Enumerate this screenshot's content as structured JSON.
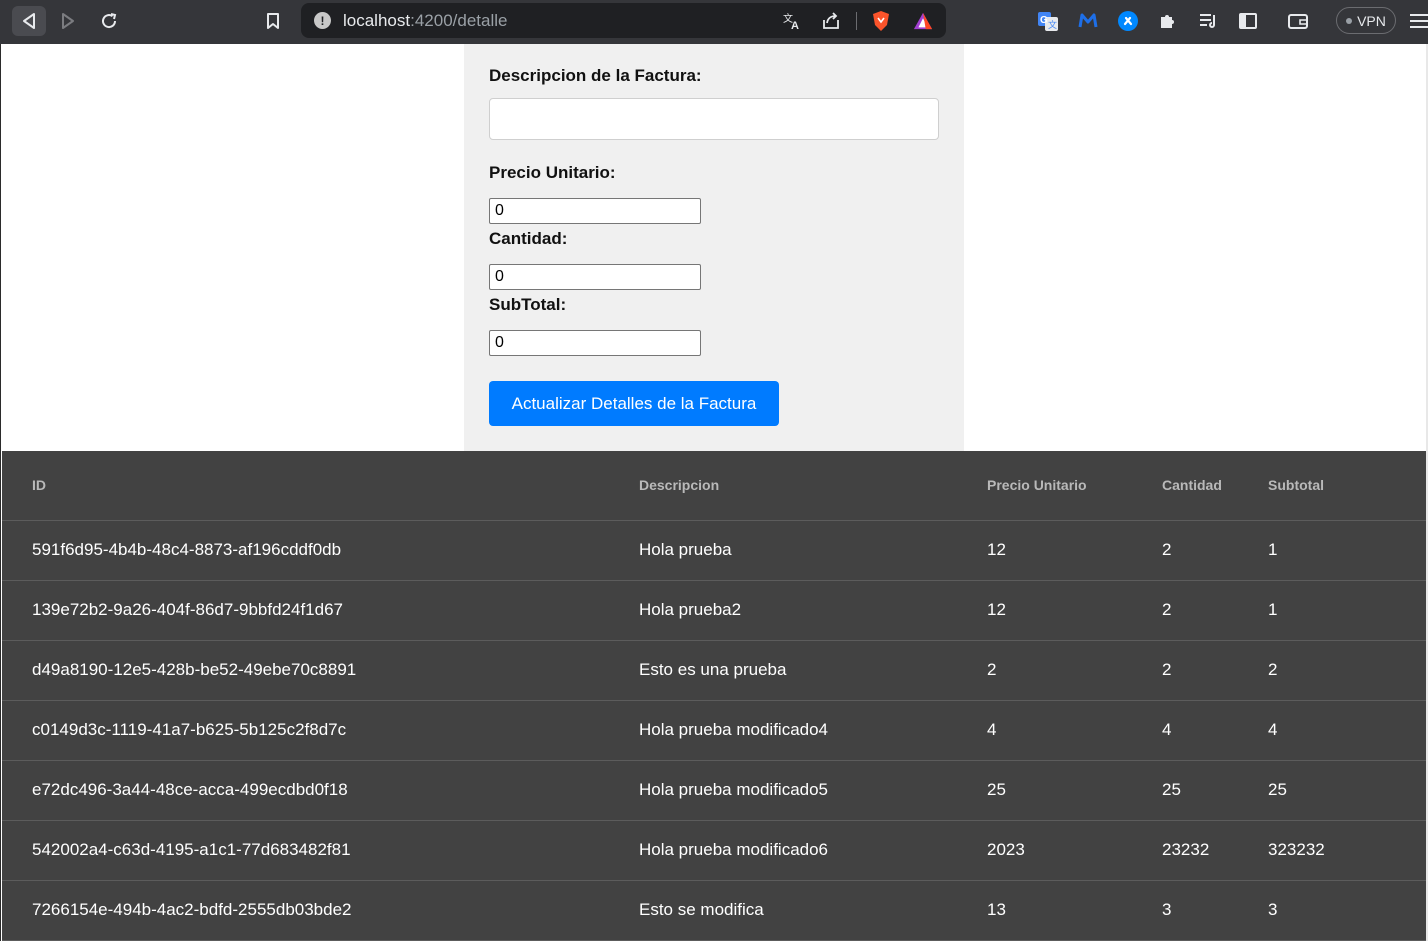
{
  "browser": {
    "url_host": "localhost",
    "url_path": ":4200/detalle",
    "vpn_label": "VPN"
  },
  "form": {
    "descripcion_label": "Descripcion de la Factura:",
    "descripcion_value": "",
    "precio_label": "Precio Unitario:",
    "precio_value": "0",
    "cantidad_label": "Cantidad:",
    "cantidad_value": "0",
    "subtotal_label": "SubTotal:",
    "subtotal_value": "0",
    "submit_label": "Actualizar Detalles de la Factura"
  },
  "table": {
    "headers": [
      "ID",
      "Descripcion",
      "Precio Unitario",
      "Cantidad",
      "Subtotal"
    ],
    "rows": [
      [
        "591f6d95-4b4b-48c4-8873-af196cddf0db",
        "Hola prueba",
        "12",
        "2",
        "1"
      ],
      [
        "139e72b2-9a26-404f-86d7-9bbfd24f1d67",
        "Hola prueba2",
        "12",
        "2",
        "1"
      ],
      [
        "d49a8190-12e5-428b-be52-49ebe70c8891",
        "Esto es una prueba",
        "2",
        "2",
        "2"
      ],
      [
        "c0149d3c-1119-41a7-b625-5b125c2f8d7c",
        "Hola prueba modificado4",
        "4",
        "4",
        "4"
      ],
      [
        "e72dc496-3a44-48ce-acca-499ecdbd0f18",
        "Hola prueba modificado5",
        "25",
        "25",
        "25"
      ],
      [
        "542002a4-c63d-4195-a1c1-77d683482f81",
        "Hola prueba modificado6",
        "2023",
        "23232",
        "323232"
      ],
      [
        "7266154e-494b-4ac2-bdfd-2555db03bde2",
        "Esto se modifica",
        "13",
        "3",
        "3"
      ]
    ]
  },
  "colors": {
    "button": "#007bff",
    "table_bg": "#424242",
    "form_bg": "#f0f0f0"
  }
}
